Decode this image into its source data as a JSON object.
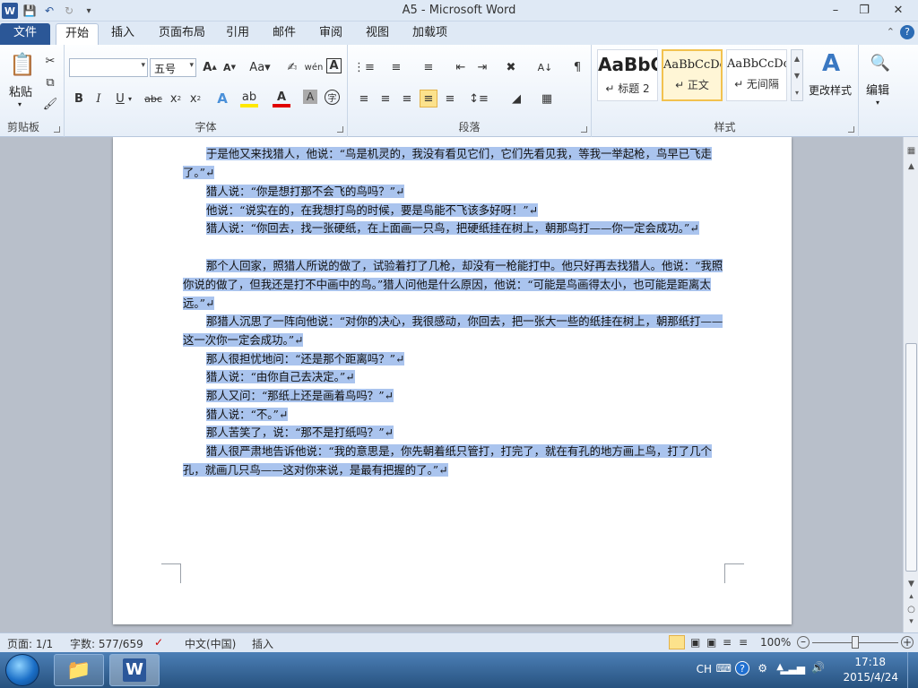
{
  "titlebar": {
    "title": "A5 - Microsoft Word"
  },
  "tabs": [
    "文件",
    "开始",
    "插入",
    "页面布局",
    "引用",
    "邮件",
    "审阅",
    "视图",
    "加载项"
  ],
  "ribbon": {
    "clipboard": {
      "label": "剪贴板",
      "paste_label": "粘贴"
    },
    "font": {
      "label": "字体",
      "font_name": "",
      "font_size": "五号"
    },
    "paragraph": {
      "label": "段落"
    },
    "styles": {
      "label": "样式",
      "items": [
        {
          "sample": "AaBbC",
          "name": "↵ 标题 2"
        },
        {
          "sample": "AaBbCcDc",
          "name": "↵ 正文"
        },
        {
          "sample": "AaBbCcDc",
          "name": "↵ 无间隔"
        }
      ],
      "change_styles_label": "更改样式"
    },
    "editing": {
      "label": "编辑"
    }
  },
  "document": {
    "paragraphs": [
      "于是他又来找猎人，他说：“鸟是机灵的，我没有看见它们，它们先看见我，等我一举起枪，鸟早已飞走了。”↵",
      "猎人说：“你是想打那不会飞的鸟吗？”↵",
      "他说：“说实在的，在我想打鸟的时候，要是鸟能不飞该多好呀！”↵",
      "猎人说：“你回去，找一张硬纸，在上面画一只鸟，把硬纸挂在树上，朝那鸟打——你一定会成功。”↵",
      "那个人回家，照猎人所说的做了，试验着打了几枪，却没有一枪能打中。他只好再去找猎人。他说：“我照你说的做了，但我还是打不中画中的鸟。”猎人问他是什么原因，他说：“可能是鸟画得太小，也可能是距离太远。”↵",
      "那猎人沉思了一阵向他说：“对你的决心，我很感动，你回去，把一张大一些的纸挂在树上，朝那纸打——这一次你一定会成功。”↵",
      "那人很担忧地问：“还是那个距离吗？”↵",
      "猎人说：“由你自己去决定。”↵",
      "那人又问：“那纸上还是画着鸟吗？”↵",
      "猎人说：“不。”↵",
      "那人苦笑了，说：“那不是打纸吗？”↵",
      "猎人很严肃地告诉他说：“我的意思是，你先朝着纸只管打，打完了，就在有孔的地方画上鸟，打了几个孔，就画几只鸟——这对你来说，是最有把握的了。”↵"
    ]
  },
  "statusbar": {
    "page": "页面: 1/1",
    "words": "字数: 577/659",
    "language": "中文(中国)",
    "mode": "插入",
    "zoom": "100%"
  },
  "taskbar": {
    "lang": "CH",
    "time": "17:18",
    "date": "2015/4/24"
  },
  "colors": {
    "accent": "#2b5797",
    "selection": "#aac4ee"
  }
}
